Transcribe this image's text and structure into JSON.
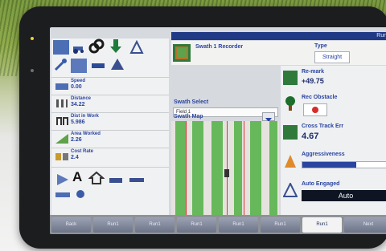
{
  "header": {
    "title_right": "Run1"
  },
  "swath": {
    "title": "Swath 1 Recorder",
    "type_label": "Type",
    "type_value": "Straight",
    "select_label": "Swath Select",
    "select_value": "Field 1",
    "map_label": "Swath Map"
  },
  "metrics": [
    {
      "label": "Speed",
      "value": "0.00"
    },
    {
      "label": "Distance",
      "value": "34.22"
    },
    {
      "label": "Dist in Work",
      "value": "5.986"
    },
    {
      "label": "Area Worked",
      "value": "2.26"
    },
    {
      "label": "Cost Rate",
      "value": "2.4"
    }
  ],
  "right": {
    "remark_label": "Re-mark",
    "remark_value": "+49.75",
    "obstacle_label": "Rec Obstacle",
    "xtrack_label": "Cross Track Err",
    "xtrack_value": "4.67",
    "aggr_label": "Aggressiveness",
    "auto_label": "Auto Engaged",
    "auto_value": "Auto"
  },
  "tabs": [
    "Back",
    "Run1",
    "Run1",
    "Run1",
    "Run1",
    "Run1",
    "Run1",
    "Next"
  ],
  "active_tab_index": 6,
  "colors": {
    "accent": "#213a86",
    "map_green": "#66b85a"
  }
}
